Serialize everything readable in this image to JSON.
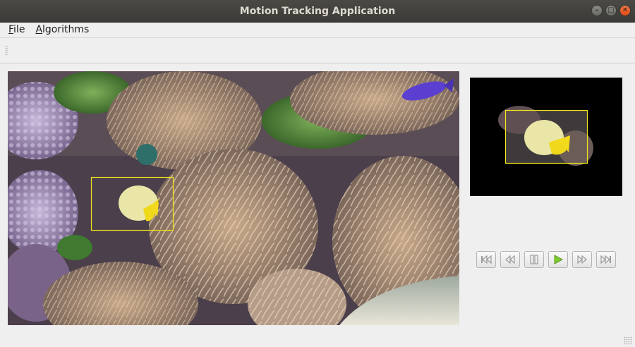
{
  "window": {
    "title": "Motion Tracking Application",
    "controls": [
      "minimize-icon",
      "maximize-icon",
      "close-icon"
    ]
  },
  "menubar": {
    "items": [
      {
        "mnemonic": "F",
        "rest": "ile"
      },
      {
        "mnemonic": "A",
        "rest": "lgorithms"
      }
    ]
  },
  "colors": {
    "tracking_box": "#f5e51a",
    "close_button": "#e95420",
    "play_icon": "#7ecb2f"
  },
  "playback": {
    "buttons": [
      "skip-to-start-icon",
      "rewind-icon",
      "pause-icon",
      "play-icon",
      "fast-forward-icon",
      "skip-to-end-icon"
    ]
  }
}
